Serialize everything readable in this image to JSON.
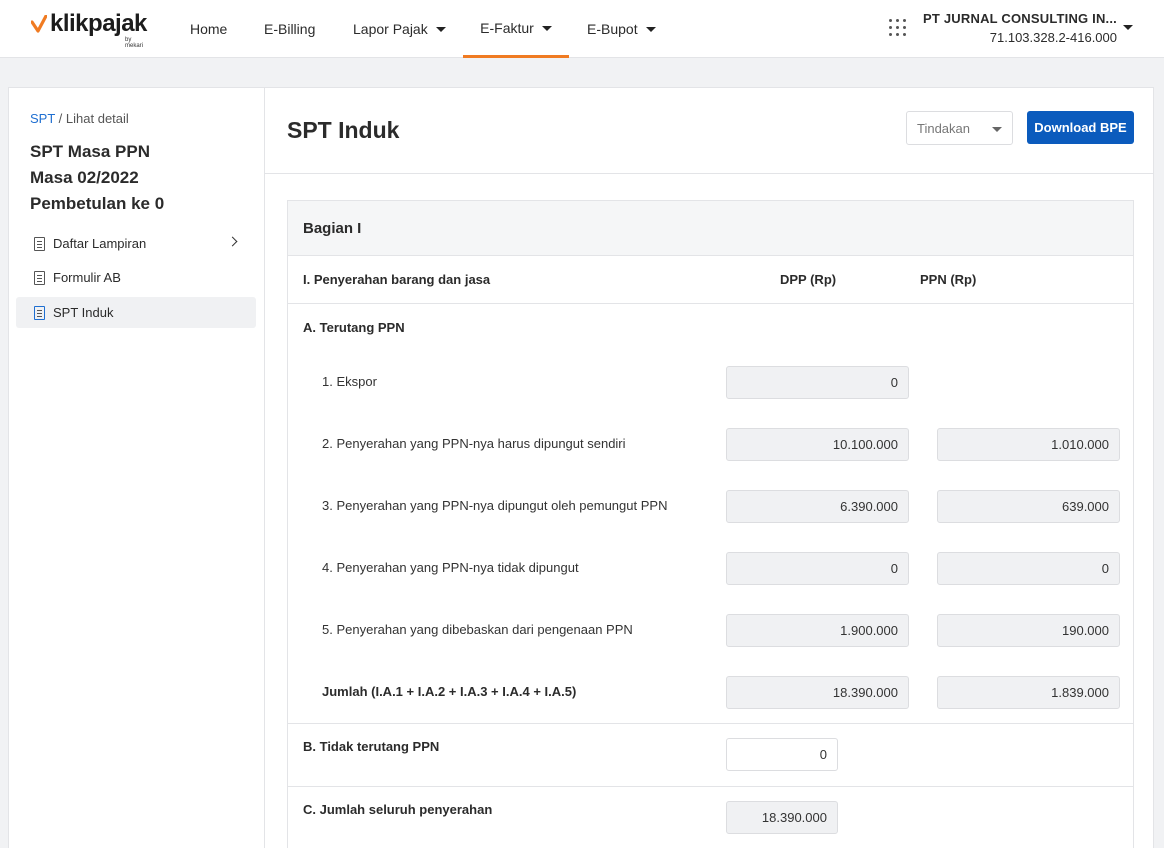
{
  "app": {
    "logo_text": "klikpajak",
    "logo_sub": "by mekari"
  },
  "nav": {
    "items": [
      {
        "label": "Home"
      },
      {
        "label": "E-Billing"
      },
      {
        "label": "Lapor Pajak"
      },
      {
        "label": "E-Faktur"
      },
      {
        "label": "E-Bupot"
      }
    ],
    "active": "E-Faktur"
  },
  "company": {
    "name": "PT JURNAL CONSULTING IN...",
    "npwp": "71.103.328.2-416.000"
  },
  "sidebar": {
    "breadcrumb_link": "SPT",
    "breadcrumb_sep": " / ",
    "breadcrumb_current": "Lihat detail",
    "title_line1": "SPT Masa PPN",
    "title_line2": "Masa 02/2022",
    "title_line3": "Pembetulan ke 0",
    "items": [
      {
        "label": "Daftar Lampiran",
        "icon": "list-icon"
      },
      {
        "label": "Formulir AB",
        "icon": "document-icon"
      },
      {
        "label": "SPT Induk",
        "icon": "document-icon"
      }
    ]
  },
  "main": {
    "title": "SPT Induk",
    "tindakan_label": "Tindakan",
    "download_label": "Download BPE"
  },
  "section": {
    "title": "Bagian I",
    "col_desc": "I. Penyerahan barang dan jasa",
    "col_dpp": "DPP (Rp)",
    "col_ppn": "PPN (Rp)",
    "group_a": "A. Terutang PPN",
    "rows": [
      {
        "label": "1. Ekspor",
        "dpp": "0",
        "ppn": null
      },
      {
        "label": "2. Penyerahan yang PPN-nya harus dipungut sendiri",
        "dpp": "10.100.000",
        "ppn": "1.010.000"
      },
      {
        "label": "3. Penyerahan yang PPN-nya dipungut oleh pemungut PPN",
        "dpp": "6.390.000",
        "ppn": "639.000"
      },
      {
        "label": "4. Penyerahan yang PPN-nya tidak dipungut",
        "dpp": "0",
        "ppn": "0"
      },
      {
        "label": "5. Penyerahan yang dibebaskan dari pengenaan PPN",
        "dpp": "1.900.000",
        "ppn": "190.000"
      }
    ],
    "jumlah_label": "Jumlah (I.A.1 + I.A.2 + I.A.3 + I.A.4 + I.A.5)",
    "jumlah_dpp": "18.390.000",
    "jumlah_ppn": "1.839.000",
    "group_b": "B. Tidak terutang PPN",
    "group_b_value": "0",
    "group_c": "C. Jumlah seluruh penyerahan",
    "group_c_value": "18.390.000"
  }
}
